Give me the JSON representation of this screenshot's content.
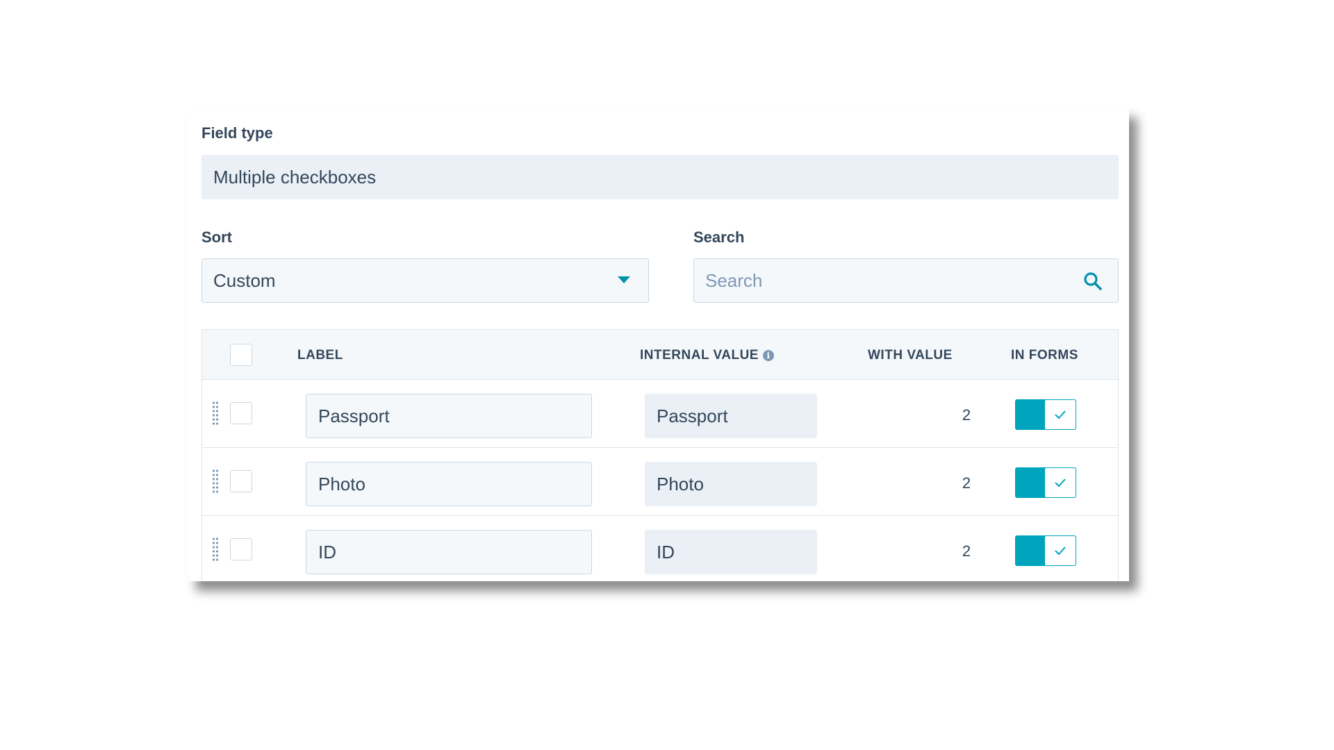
{
  "field_type": {
    "label": "Field type",
    "value": "Multiple checkboxes"
  },
  "sort": {
    "label": "Sort",
    "value": "Custom"
  },
  "search": {
    "label": "Search",
    "placeholder": "Search"
  },
  "table": {
    "columns": {
      "label": "LABEL",
      "internal_value": "INTERNAL VALUE",
      "with_value": "WITH VALUE",
      "in_forms": "IN FORMS"
    },
    "rows": [
      {
        "label": "Passport",
        "internal_value": "Passport",
        "with_value": "2",
        "in_forms": true
      },
      {
        "label": "Photo",
        "internal_value": "Photo",
        "with_value": "2",
        "in_forms": true
      },
      {
        "label": "ID",
        "internal_value": "ID",
        "with_value": "2",
        "in_forms": true
      }
    ]
  },
  "icons": {
    "sort_dropdown": "caret-down-icon",
    "search": "search-icon",
    "info": "info-icon",
    "drag": "drag-handle-icon",
    "toggle_on": "checkmark-icon"
  },
  "colors": {
    "accent": "#00a4bd",
    "link": "#0091ae",
    "text": "#33475b",
    "field_bg": "#eaf0f6",
    "input_bg": "#f5f8fa",
    "border": "#cbd6e2"
  }
}
